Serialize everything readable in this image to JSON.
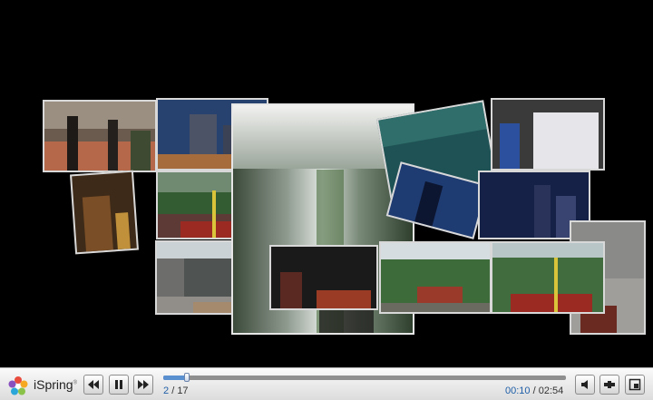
{
  "player": {
    "brand": "iSpring",
    "brand_mark": "®"
  },
  "slides": {
    "current": "2",
    "separator": "/",
    "total": "17"
  },
  "time": {
    "current": "00:10",
    "separator": "/",
    "total": "02:54"
  },
  "progress": {
    "fraction": 0.0575
  },
  "colors": {
    "accent": "#1f5fa8",
    "progress_fill": "#5a8fd0"
  },
  "icons": {
    "logo": "ispring-flower-icon",
    "rewind": "previous-slide-icon",
    "pause": "pause-icon",
    "forward": "next-slide-icon",
    "volume": "speaker-icon",
    "outline": "outline-icon",
    "fullscreen": "fullscreen-icon"
  }
}
